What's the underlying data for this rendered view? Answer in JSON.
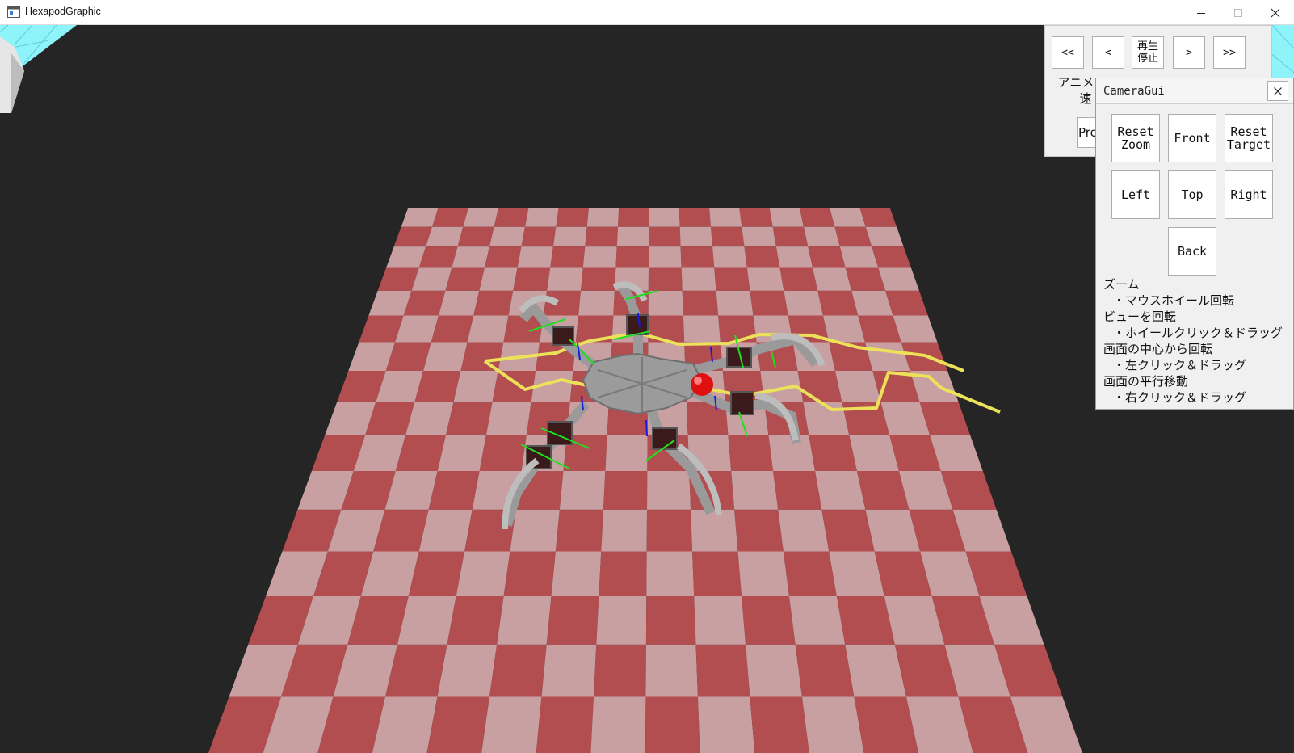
{
  "window": {
    "title": "HexapodGraphic",
    "icon": "app-window-icon",
    "controls": [
      "minimize-icon",
      "maximize-icon",
      "close-icon"
    ]
  },
  "animation_panel": {
    "buttons": {
      "first": "<<",
      "prev_frame": "<",
      "play_stop_line1": "再生",
      "play_stop_line2": "停止",
      "next_frame": ">",
      "last": ">>"
    },
    "speed_label_line1": "アニメ",
    "speed_label_line2": "速",
    "prev_button": "Pre"
  },
  "camera_gui": {
    "title": "CameraGui",
    "buttons": {
      "reset_zoom_1": "Reset",
      "reset_zoom_2": "Zoom",
      "front": "Front",
      "reset_target_1": "Reset",
      "reset_target_2": "Target",
      "left": "Left",
      "top": "Top",
      "right": "Right",
      "back": "Back"
    },
    "help": [
      {
        "heading": "ズーム",
        "item": "・マウスホイール回転"
      },
      {
        "heading": "ビューを回転",
        "item": "・ホイールクリック＆ドラッグ"
      },
      {
        "heading": "画面の中心から回転",
        "item": "・左クリック＆ドラッグ"
      },
      {
        "heading": "画面の平行移動",
        "item": "・右クリック＆ドラッグ"
      }
    ]
  },
  "scene": {
    "background": "#252525",
    "floor_dark": "#b34e50",
    "floor_light": "#c9a0a2",
    "path_color": "#ece25a",
    "body_marker": "#e01010",
    "robot": "hexapod-robot"
  }
}
